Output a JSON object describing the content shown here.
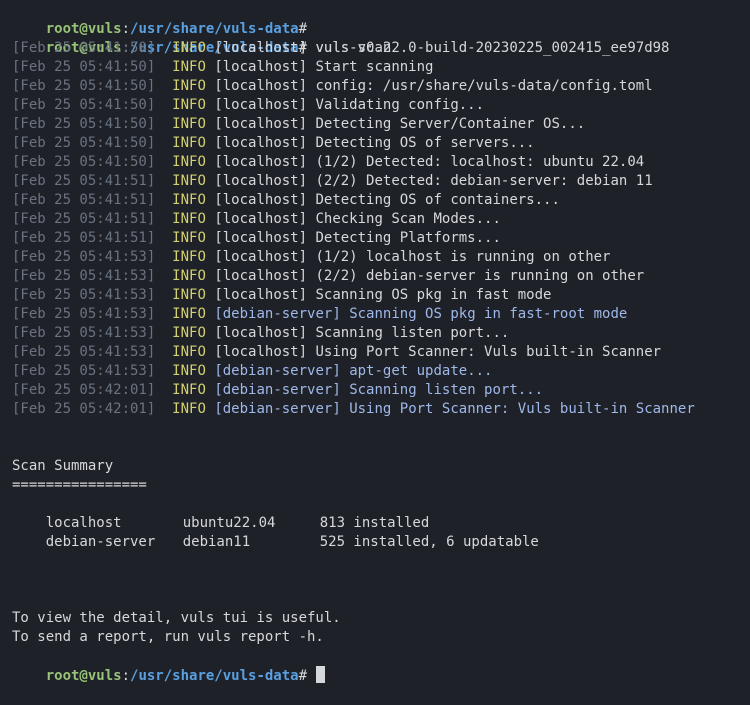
{
  "colors": {
    "background": "#1e2127",
    "text": "#d6d8dc",
    "prompt_user": "#98c379",
    "prompt_path": "#5aa0e0",
    "timestamp": "#6b7280",
    "info": "#d4d06f",
    "debian_log": "#9fb8ea"
  },
  "prompt": {
    "user": "root@vuls",
    "sep": ":",
    "path": "/usr/share/vuls-data",
    "symbol": "#"
  },
  "command": "vuls scan",
  "logs": [
    {
      "ts": "[Feb 25 05:41:50]",
      "level": "INFO",
      "host": "[localhost]",
      "msg": "vuls-v0.22.0-build-20230225_002415_ee97d98",
      "kind": "local"
    },
    {
      "ts": "[Feb 25 05:41:50]",
      "level": "INFO",
      "host": "[localhost]",
      "msg": "Start scanning",
      "kind": "local"
    },
    {
      "ts": "[Feb 25 05:41:50]",
      "level": "INFO",
      "host": "[localhost]",
      "msg": "config: /usr/share/vuls-data/config.toml",
      "kind": "local"
    },
    {
      "ts": "[Feb 25 05:41:50]",
      "level": "INFO",
      "host": "[localhost]",
      "msg": "Validating config...",
      "kind": "local"
    },
    {
      "ts": "[Feb 25 05:41:50]",
      "level": "INFO",
      "host": "[localhost]",
      "msg": "Detecting Server/Container OS...",
      "kind": "local"
    },
    {
      "ts": "[Feb 25 05:41:50]",
      "level": "INFO",
      "host": "[localhost]",
      "msg": "Detecting OS of servers...",
      "kind": "local"
    },
    {
      "ts": "[Feb 25 05:41:50]",
      "level": "INFO",
      "host": "[localhost]",
      "msg": "(1/2) Detected: localhost: ubuntu 22.04",
      "kind": "local"
    },
    {
      "ts": "[Feb 25 05:41:51]",
      "level": "INFO",
      "host": "[localhost]",
      "msg": "(2/2) Detected: debian-server: debian 11",
      "kind": "local"
    },
    {
      "ts": "[Feb 25 05:41:51]",
      "level": "INFO",
      "host": "[localhost]",
      "msg": "Detecting OS of containers...",
      "kind": "local"
    },
    {
      "ts": "[Feb 25 05:41:51]",
      "level": "INFO",
      "host": "[localhost]",
      "msg": "Checking Scan Modes...",
      "kind": "local"
    },
    {
      "ts": "[Feb 25 05:41:51]",
      "level": "INFO",
      "host": "[localhost]",
      "msg": "Detecting Platforms...",
      "kind": "local"
    },
    {
      "ts": "[Feb 25 05:41:53]",
      "level": "INFO",
      "host": "[localhost]",
      "msg": "(1/2) localhost is running on other",
      "kind": "local"
    },
    {
      "ts": "[Feb 25 05:41:53]",
      "level": "INFO",
      "host": "[localhost]",
      "msg": "(2/2) debian-server is running on other",
      "kind": "local"
    },
    {
      "ts": "[Feb 25 05:41:53]",
      "level": "INFO",
      "host": "[localhost]",
      "msg": "Scanning OS pkg in fast mode",
      "kind": "local"
    },
    {
      "ts": "[Feb 25 05:41:53]",
      "level": "INFO",
      "host": "[debian-server]",
      "msg": "Scanning OS pkg in fast-root mode",
      "kind": "debian"
    },
    {
      "ts": "[Feb 25 05:41:53]",
      "level": "INFO",
      "host": "[localhost]",
      "msg": "Scanning listen port...",
      "kind": "local"
    },
    {
      "ts": "[Feb 25 05:41:53]",
      "level": "INFO",
      "host": "[localhost]",
      "msg": "Using Port Scanner: Vuls built-in Scanner",
      "kind": "local"
    },
    {
      "ts": "[Feb 25 05:41:53]",
      "level": "INFO",
      "host": "[debian-server]",
      "msg": "apt-get update...",
      "kind": "debian"
    },
    {
      "ts": "[Feb 25 05:42:01]",
      "level": "INFO",
      "host": "[debian-server]",
      "msg": "Scanning listen port...",
      "kind": "debian"
    },
    {
      "ts": "[Feb 25 05:42:01]",
      "level": "INFO",
      "host": "[debian-server]",
      "msg": "Using Port Scanner: Vuls built-in Scanner",
      "kind": "debian"
    }
  ],
  "summary": {
    "title": "Scan Summary",
    "underline": "================",
    "rows": [
      {
        "host": "localhost",
        "os": "ubuntu22.04",
        "status": "813 installed"
      },
      {
        "host": "debian-server",
        "os": "debian11",
        "status": "525 installed, 6 updatable"
      }
    ]
  },
  "footer": [
    "To view the detail, vuls tui is useful.",
    "To send a report, run vuls report -h."
  ]
}
